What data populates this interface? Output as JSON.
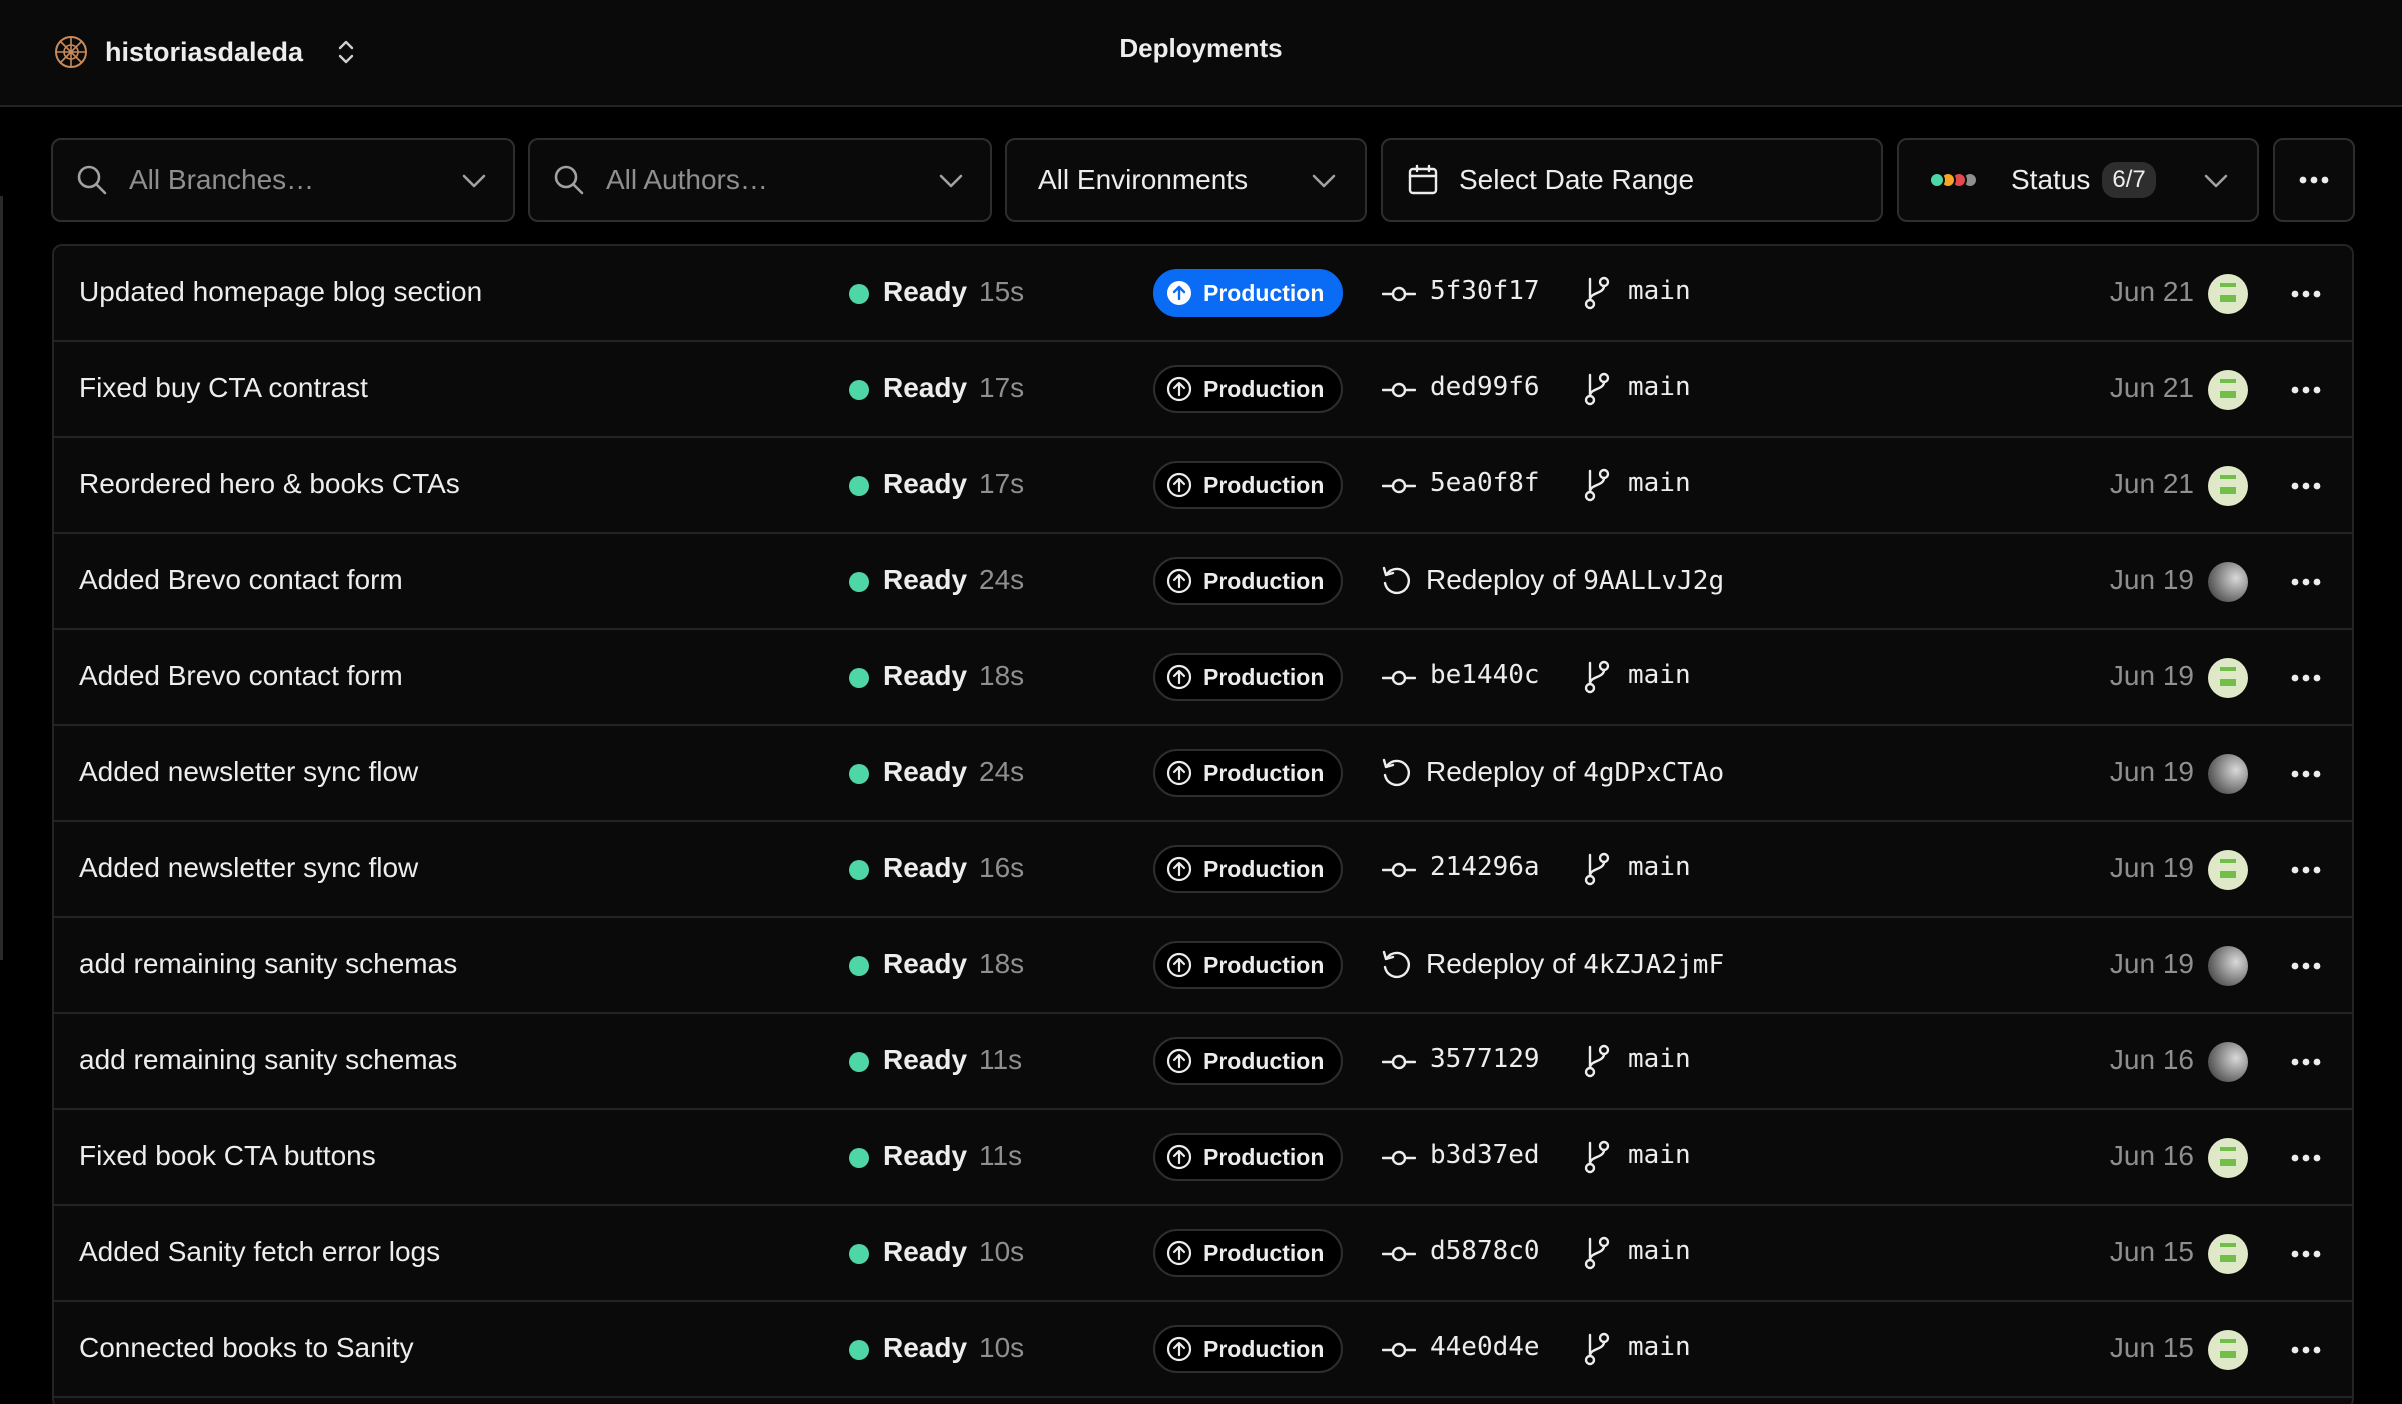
{
  "header": {
    "team_name": "historiasdaleda",
    "page_title": "Deployments"
  },
  "filters": {
    "branches_placeholder": "All Branches…",
    "authors_placeholder": "All Authors…",
    "environment_value": "All Environments",
    "date_range_label": "Select Date Range",
    "status_label": "Status",
    "status_count": "6/7",
    "status_dot_colors": [
      "#4fd6a6",
      "#f5a623",
      "#e5484d",
      "#8f8f8f"
    ]
  },
  "colors": {
    "ready": "#4fd6a6",
    "production_active": "#0a6cf5"
  },
  "deployments": [
    {
      "title": "Updated homepage blog section",
      "status": "Ready",
      "duration": "15s",
      "environment": "Production",
      "current": true,
      "commit": "5f30f17",
      "branch": "main",
      "date": "Jun 21",
      "avatar": "green-icon"
    },
    {
      "title": "Fixed buy CTA contrast",
      "status": "Ready",
      "duration": "17s",
      "environment": "Production",
      "current": false,
      "commit": "ded99f6",
      "branch": "main",
      "date": "Jun 21",
      "avatar": "green-icon"
    },
    {
      "title": "Reordered hero & books CTAs",
      "status": "Ready",
      "duration": "17s",
      "environment": "Production",
      "current": false,
      "commit": "5ea0f8f",
      "branch": "main",
      "date": "Jun 21",
      "avatar": "green-icon"
    },
    {
      "title": "Added Brevo contact form",
      "status": "Ready",
      "duration": "24s",
      "environment": "Production",
      "current": false,
      "redeploy_label": "Redeploy of",
      "redeploy_id": "9AALLvJ2g",
      "date": "Jun 19",
      "avatar": "grey-gradient"
    },
    {
      "title": "Added Brevo contact form",
      "status": "Ready",
      "duration": "18s",
      "environment": "Production",
      "current": false,
      "commit": "be1440c",
      "branch": "main",
      "date": "Jun 19",
      "avatar": "green-icon"
    },
    {
      "title": "Added newsletter sync flow",
      "status": "Ready",
      "duration": "24s",
      "environment": "Production",
      "current": false,
      "redeploy_label": "Redeploy of",
      "redeploy_id": "4gDPxCTAo",
      "date": "Jun 19",
      "avatar": "grey-gradient"
    },
    {
      "title": "Added newsletter sync flow",
      "status": "Ready",
      "duration": "16s",
      "environment": "Production",
      "current": false,
      "commit": "214296a",
      "branch": "main",
      "date": "Jun 19",
      "avatar": "green-icon"
    },
    {
      "title": "add remaining sanity schemas",
      "status": "Ready",
      "duration": "18s",
      "environment": "Production",
      "current": false,
      "redeploy_label": "Redeploy of",
      "redeploy_id": "4kZJA2jmF",
      "date": "Jun 19",
      "avatar": "grey-gradient"
    },
    {
      "title": "add remaining sanity schemas",
      "status": "Ready",
      "duration": "11s",
      "environment": "Production",
      "current": false,
      "commit": "3577129",
      "branch": "main",
      "date": "Jun 16",
      "avatar": "grey-gradient"
    },
    {
      "title": "Fixed book CTA buttons",
      "status": "Ready",
      "duration": "11s",
      "environment": "Production",
      "current": false,
      "commit": "b3d37ed",
      "branch": "main",
      "date": "Jun 16",
      "avatar": "green-icon"
    },
    {
      "title": "Added Sanity fetch error logs",
      "status": "Ready",
      "duration": "10s",
      "environment": "Production",
      "current": false,
      "commit": "d5878c0",
      "branch": "main",
      "date": "Jun 15",
      "avatar": "green-icon"
    },
    {
      "title": "Connected books to Sanity",
      "status": "Ready",
      "duration": "10s",
      "environment": "Production",
      "current": false,
      "commit": "44e0d4e",
      "branch": "main",
      "date": "Jun 15",
      "avatar": "green-icon"
    }
  ]
}
